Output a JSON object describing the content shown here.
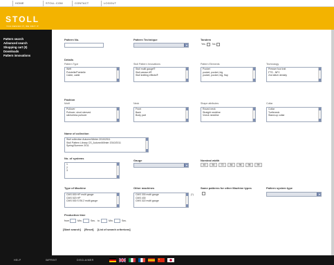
{
  "topnav": {
    "links": [
      "HOME",
      "STOLL.COM",
      "CONTACT",
      "LOGOUT"
    ]
  },
  "brand": {
    "logo": "STOLL",
    "slogan": "YOU DESIGN IT, WE KNIT IT"
  },
  "sidebar": {
    "items": [
      {
        "label": "Pattern search"
      },
      {
        "label": "Advanced search"
      },
      {
        "label": "Shopping cart (0)"
      },
      {
        "label": "Downloads"
      },
      {
        "label": "Pattern innovations"
      }
    ]
  },
  "form": {
    "pattern_no_label": "Pattern No.",
    "pattern_technique_label": "Pattern Technique",
    "tandem_label": "Tandem",
    "tandem_yes": "Yes",
    "tandem_no": "No",
    "details_label": "Details",
    "pattern_type_label": "Pattern Type",
    "pattern_type_options": [
      "Weft",
      "Pointelle/Pointelle",
      "Cable, cable"
    ],
    "stoll_innovations_label": "Stoll Pattern Innovations",
    "stoll_innovations_options": [
      "Stoll multi gauge®",
      "Stoll-weave-it®",
      "Stoll knitting effects®"
    ],
    "pattern_elements_label": "Pattern Elements",
    "pattern_elements_options": [
      "Pocket",
      "pocket, pocket, big",
      "pocket, pocket, big, flap"
    ],
    "technology_label": "Technology",
    "technology_options": [
      "Presser foot knit",
      "FTS - NPJ",
      "2nd stitch density"
    ],
    "fashion_label": "Fashion",
    "motif_label": "Motif",
    "motif_options": [
      "Pullover",
      "Pullover, short sleeved",
      "sleeveless pullover"
    ],
    "neck_label": "Neck",
    "neck_options": [
      "Front",
      "Back",
      "Body part"
    ],
    "shape_label": "Shape attributes",
    "shape_options": [
      "Round neck",
      "Straight neckline",
      "Vneck neckline"
    ],
    "collar_label": "Collar",
    "collar_options": [
      "Collar",
      "Turtleneck",
      "Stand-up collar"
    ],
    "collection_label": "Name of collection",
    "collection_options": [
      "Stoll collection Autumn/Winter 2010/2011",
      "Stoll Pattern Library CS_Autumn/Winter 2010/2011",
      "Spring/Summer 2011"
    ],
    "systems_label": "No. of systems",
    "systems_options": [
      "1",
      "2",
      "3"
    ],
    "gauge_label": "Gauge",
    "nominal_width_label": "Nominal width",
    "nominal_widths": [
      "40",
      "50",
      "72",
      "84",
      "96",
      "98",
      "99"
    ],
    "machine_type_label": "Type of Machine",
    "machine_type_options": [
      "CMS 830 HP multi gauge",
      "CMS 520 HP",
      "CMS 530 S E6.2 multi gauge"
    ],
    "other_machines_label": "Other machines",
    "other_machines_options": [
      "CMS 330 multi gauge",
      "CMS 430",
      "CMS 322 multi gauge"
    ],
    "other_machines_note": "(*)",
    "same_patterns_label": "Same patterns for other Machine types",
    "pattern_system_label": "Pattern system type",
    "production_time_label": "Production time",
    "prod_from": "from",
    "prod_min1": "Min.",
    "prod_sec1": "Sec.",
    "prod_to": "to",
    "prod_min2": "Min.",
    "prod_sec2": "Sec.",
    "actions": [
      "[Start search]",
      "[Reset]",
      "[List of search criterions]"
    ]
  },
  "footer": {
    "links": [
      "HELP",
      "IMPRINT",
      "DISCLAIMER"
    ],
    "flags": [
      "german-flag",
      "uk-flag",
      "italian-flag",
      "french-flag",
      "spanish-flag",
      "chinese-flag",
      "japanese-flag"
    ]
  },
  "colors": {
    "brand": "#f3b300",
    "sidebar_bg": "#141414",
    "accent": "#7e8fb3"
  }
}
